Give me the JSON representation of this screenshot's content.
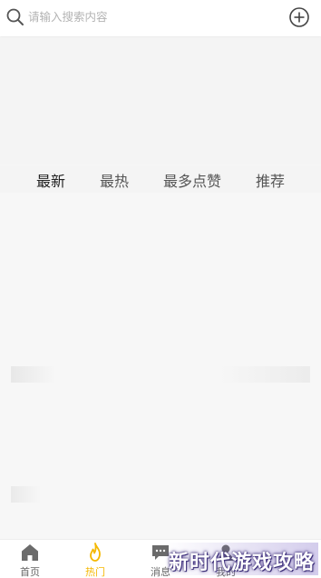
{
  "search": {
    "placeholder": "请输入搜索内容",
    "icon": "search-icon",
    "add_icon": "plus-circle-icon"
  },
  "tabs": [
    {
      "label": "最新",
      "active": true
    },
    {
      "label": "最热",
      "active": false
    },
    {
      "label": "最多点赞",
      "active": false
    },
    {
      "label": "推荐",
      "active": false
    }
  ],
  "nav": [
    {
      "label": "首页",
      "icon": "home-icon",
      "active": false
    },
    {
      "label": "热门",
      "icon": "flame-icon",
      "active": true
    },
    {
      "label": "消息",
      "icon": "message-icon",
      "active": false
    },
    {
      "label": "我的",
      "icon": "user-icon",
      "active": false
    }
  ],
  "watermark": "新时代游戏攻略",
  "colors": {
    "accent": "#f5b800",
    "header_bg": "#ffffff",
    "page_bg": "#f6f6f6"
  }
}
